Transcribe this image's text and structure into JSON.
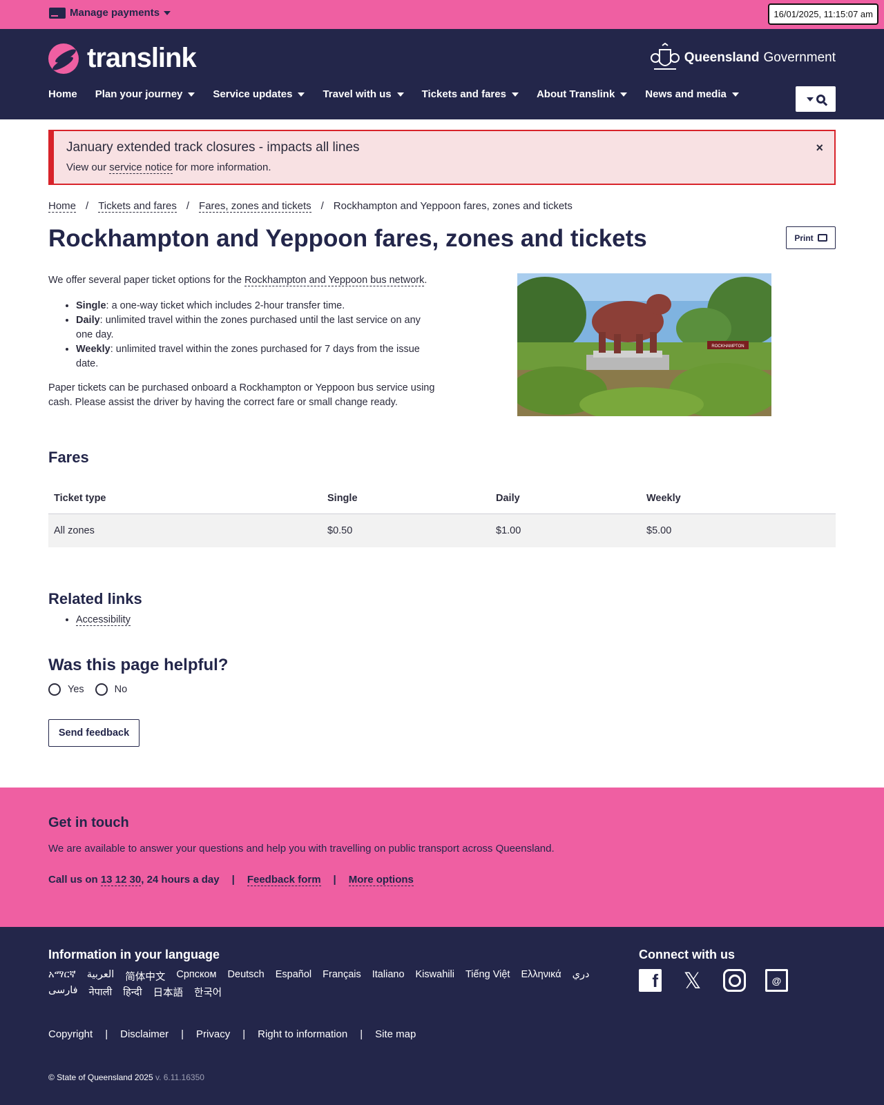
{
  "topbar": {
    "manage_payments": "Manage payments",
    "timestamp": "16/01/2025, 11:15:07 am"
  },
  "header": {
    "logo_text": "translink",
    "gov_bold": "Queensland",
    "gov_light": "Government",
    "nav": [
      {
        "label": "Home"
      },
      {
        "label": "Plan your journey"
      },
      {
        "label": "Service updates"
      },
      {
        "label": "Travel with us"
      },
      {
        "label": "Tickets and fares"
      },
      {
        "label": "About Translink"
      },
      {
        "label": "News and media"
      }
    ]
  },
  "alert": {
    "title": "January extended track closures - impacts all lines",
    "text_before": "View our ",
    "link": "service notice",
    "text_after": " for more information.",
    "close": "×"
  },
  "breadcrumb": [
    "Home",
    "Tickets and fares",
    "Fares, zones and tickets",
    "Rockhampton and Yeppoon fares, zones and tickets"
  ],
  "page": {
    "title": "Rockhampton and Yeppoon fares, zones and tickets",
    "print_label": "Print",
    "intro_before": "We offer several paper ticket options for the ",
    "intro_link": "Rockhampton and Yeppoon bus network",
    "intro_after": ".",
    "tickets": [
      {
        "name": "Single",
        "desc": ": a one-way ticket which includes 2-hour transfer time."
      },
      {
        "name": "Daily",
        "desc": ": unlimited travel within the zones purchased until the last service on any one day."
      },
      {
        "name": "Weekly",
        "desc": ": unlimited travel within the zones purchased for 7 days from the issue date."
      }
    ],
    "purchase_note": "Paper tickets can be purchased onboard a Rockhampton or Yeppoon bus service using cash. Please assist the driver by having the correct fare or small change ready.",
    "photo_sign": "ROCKHAMPTON"
  },
  "fares": {
    "heading": "Fares",
    "headers": [
      "Ticket type",
      "Single",
      "Daily",
      "Weekly"
    ],
    "rows": [
      [
        "All zones",
        "$0.50",
        "$1.00",
        "$5.00"
      ]
    ]
  },
  "related": {
    "heading": "Related links",
    "links": [
      "Accessibility"
    ]
  },
  "feedback": {
    "heading": "Was this page helpful?",
    "yes": "Yes",
    "no": "No",
    "send": "Send feedback"
  },
  "touch": {
    "heading": "Get in touch",
    "text": "We are available to answer your questions and help you with travelling on public transport across Queensland.",
    "call_prefix": "Call us on ",
    "call_number": "13 12 30",
    "call_suffix": ", 24 hours a day",
    "feedback_form": "Feedback form",
    "more_options": "More options"
  },
  "footer": {
    "lang_heading": "Information in your language",
    "languages": [
      "አማርኛ",
      "العربية",
      "简体中文",
      "Српском",
      "Deutsch",
      "Español",
      "Français",
      "Italiano",
      "Kiswahili",
      "Tiếng Việt",
      "Ελληνικά",
      "دري",
      "فارسی",
      "नेपाली",
      "हिन्दी",
      "日本語",
      "한국어"
    ],
    "connect_heading": "Connect with us",
    "legal": [
      "Copyright",
      "Disclaimer",
      "Privacy",
      "Right to information",
      "Site map"
    ],
    "copyright": "© State of Queensland 2025",
    "version": "v. 6.11.16350"
  },
  "colors": {
    "pink": "#ef5fa2",
    "navy": "#23264a",
    "alert_bg": "#f8e1e3",
    "alert_border": "#d8232a"
  }
}
